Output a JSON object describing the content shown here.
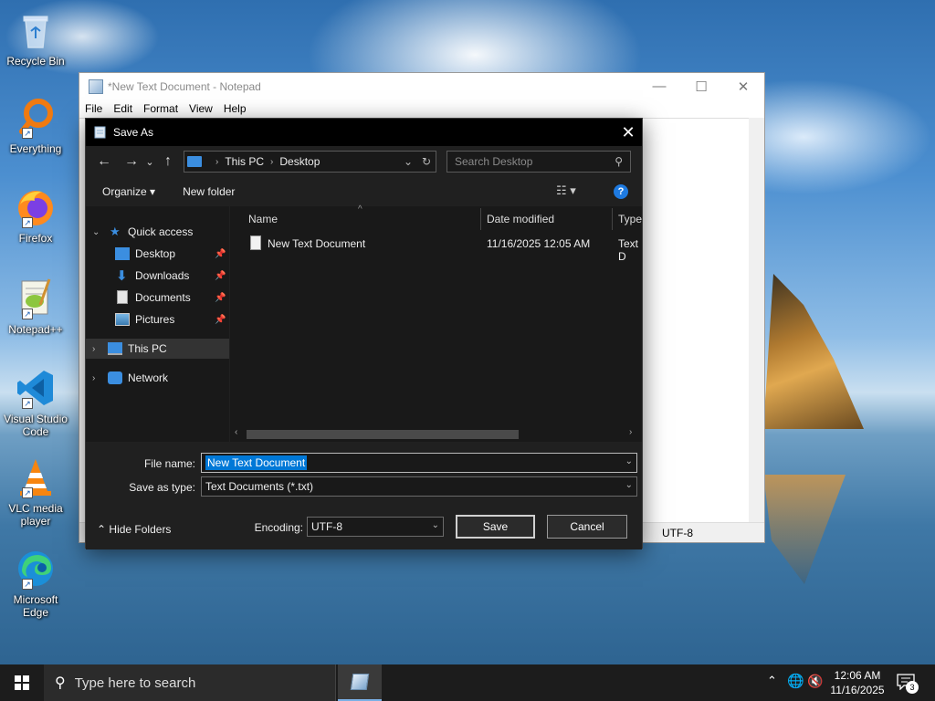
{
  "desktop": {
    "icons": [
      {
        "label": "Recycle Bin",
        "icon": "recycle-bin-icon"
      },
      {
        "label": "Everything",
        "icon": "search-app-icon"
      },
      {
        "label": "Firefox",
        "icon": "firefox-icon"
      },
      {
        "label": "Notepad++",
        "icon": "notepadpp-icon"
      },
      {
        "label": "Visual Studio Code",
        "icon": "vscode-icon"
      },
      {
        "label": "VLC media player",
        "icon": "vlc-icon"
      },
      {
        "label": "Microsoft Edge",
        "icon": "edge-icon"
      }
    ]
  },
  "notepad": {
    "title": "*New Text Document - Notepad",
    "menu": [
      "File",
      "Edit",
      "Format",
      "View",
      "Help"
    ],
    "status_encoding": "UTF-8",
    "controls": {
      "minimize": "—",
      "maximize": "☐",
      "close": "✕"
    }
  },
  "dialog": {
    "title": "Save As",
    "close_glyph": "✕",
    "nav": {
      "back": "←",
      "forward": "→",
      "recent": "⌄",
      "up": "↑"
    },
    "address": {
      "segments": [
        "This PC",
        "Desktop"
      ],
      "separator": "›"
    },
    "search_placeholder": "Search Desktop",
    "toolbar": {
      "organize": "Organize ▾",
      "new_folder": "New folder",
      "view": "☷ ▾",
      "help": "?"
    },
    "nav_pane": {
      "quick_access": "Quick access",
      "quick_items": [
        {
          "label": "Desktop"
        },
        {
          "label": "Downloads"
        },
        {
          "label": "Documents"
        },
        {
          "label": "Pictures"
        }
      ],
      "this_pc": "This PC",
      "network": "Network"
    },
    "columns": {
      "name": "Name",
      "date_modified": "Date modified",
      "type": "Type"
    },
    "files": [
      {
        "name": "New Text Document",
        "date_modified": "11/16/2025 12:05 AM",
        "type": "Text D"
      }
    ],
    "form": {
      "file_name_label": "File name:",
      "file_name_value": "New Text Document",
      "save_as_type_label": "Save as type:",
      "save_as_type_value": "Text Documents (*.txt)",
      "encoding_label": "Encoding:",
      "encoding_value": "UTF-8",
      "hide_folders": "Hide Folders",
      "save_button": "Save",
      "cancel_button": "Cancel"
    }
  },
  "taskbar": {
    "search_placeholder": "Type here to search",
    "clock_time": "12:06 AM",
    "clock_date": "11/16/2025",
    "notification_count": "3"
  }
}
